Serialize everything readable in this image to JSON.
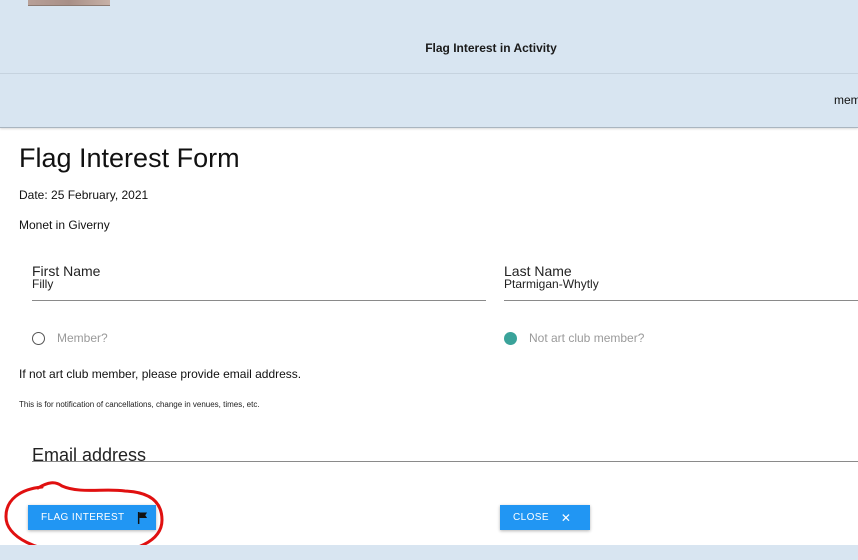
{
  "header": {
    "title": "Flag Interest in Activity",
    "nav_text": "mem"
  },
  "form": {
    "title": "Flag Interest Form",
    "date": "Date: 25 February, 2021",
    "activity": "Monet in Giverny",
    "first_name": {
      "label": "First Name",
      "value": "Filly"
    },
    "last_name": {
      "label": "Last Name",
      "value": "Ptarmigan-Whytly"
    },
    "member_option": {
      "label": "Member?",
      "checked": false
    },
    "non_member_option": {
      "label": "Not art club member?",
      "checked": true
    },
    "note": "If not art club member, please provide email address.",
    "small_note": "This is for notification of cancellations, change in venues, times, etc.",
    "email": {
      "label": "Email address",
      "value": ""
    }
  },
  "buttons": {
    "flag_label": "FLAG INTEREST",
    "flag_icon": "flag-icon",
    "close_label": "CLOSE",
    "close_icon": "close-icon"
  },
  "colors": {
    "header_bg": "#d8e5f1",
    "button": "#2196f3",
    "radio_checked": "#3aa39a",
    "annotation": "#e01010"
  }
}
